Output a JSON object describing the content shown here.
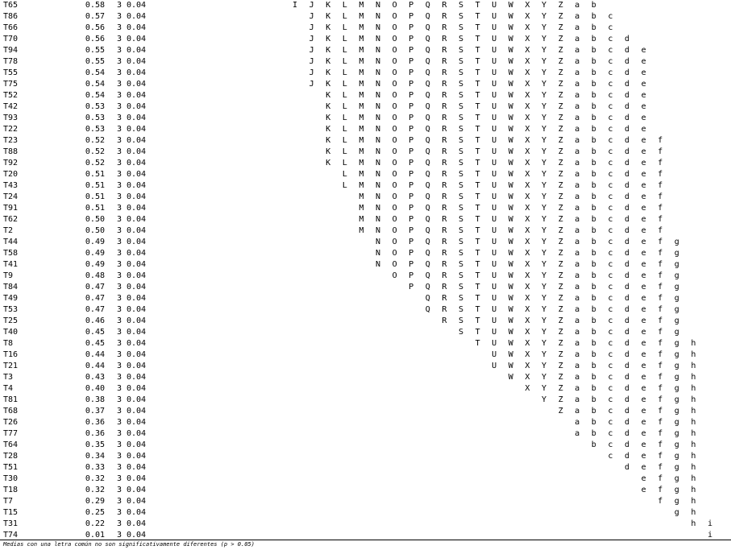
{
  "footnote": "Medias con una letra común no son significativamente diferentes (p > 0.05)",
  "rows": [
    {
      "name": "T65",
      "mean": "0.58",
      "n": "3",
      "ee": "0.04",
      "letters": "IJKLMNOPQRSTUWXYZab"
    },
    {
      "name": "T86",
      "mean": "0.57",
      "n": "3",
      "ee": "0.04",
      "letters": "JKLMNOPQRSTUWXYZabc"
    },
    {
      "name": "T66",
      "mean": "0.56",
      "n": "3",
      "ee": "0.04",
      "letters": "JKLMNOPQRSTUWXYZabc"
    },
    {
      "name": "T70",
      "mean": "0.56",
      "n": "3",
      "ee": "0.04",
      "letters": "JKLMNOPQRSTUWXYZabcd"
    },
    {
      "name": "T94",
      "mean": "0.55",
      "n": "3",
      "ee": "0.04",
      "letters": "JKLMNOPQRSTUWXYZabcde"
    },
    {
      "name": "T78",
      "mean": "0.55",
      "n": "3",
      "ee": "0.04",
      "letters": "JKLMNOPQRSTUWXYZabcde"
    },
    {
      "name": "T55",
      "mean": "0.54",
      "n": "3",
      "ee": "0.04",
      "letters": "JKLMNOPQRSTUWXYZabcde"
    },
    {
      "name": "T75",
      "mean": "0.54",
      "n": "3",
      "ee": "0.04",
      "letters": "JKLMNOPQRSTUWXYZabcde"
    },
    {
      "name": "T52",
      "mean": "0.54",
      "n": "3",
      "ee": "0.04",
      "letters": "KLMNOPQRSTUWXYZabcde"
    },
    {
      "name": "T42",
      "mean": "0.53",
      "n": "3",
      "ee": "0.04",
      "letters": "KLMNOPQRSTUWXYZabcde"
    },
    {
      "name": "T93",
      "mean": "0.53",
      "n": "3",
      "ee": "0.04",
      "letters": "KLMNOPQRSTUWXYZabcde"
    },
    {
      "name": "T22",
      "mean": "0.53",
      "n": "3",
      "ee": "0.04",
      "letters": "KLMNOPQRSTUWXYZabcde"
    },
    {
      "name": "T23",
      "mean": "0.52",
      "n": "3",
      "ee": "0.04",
      "letters": "KLMNOPQRSTUWXYZabcdef"
    },
    {
      "name": "T88",
      "mean": "0.52",
      "n": "3",
      "ee": "0.04",
      "letters": "KLMNOPQRSTUWXYZabcdef"
    },
    {
      "name": "T92",
      "mean": "0.52",
      "n": "3",
      "ee": "0.04",
      "letters": "KLMNOPQRSTUWXYZabcdef"
    },
    {
      "name": "T20",
      "mean": "0.51",
      "n": "3",
      "ee": "0.04",
      "letters": "LMNOPQRSTUWXYZabcdef"
    },
    {
      "name": "T43",
      "mean": "0.51",
      "n": "3",
      "ee": "0.04",
      "letters": "LMNOPQRSTUWXYZabcdef"
    },
    {
      "name": "T24",
      "mean": "0.51",
      "n": "3",
      "ee": "0.04",
      "letters": "MNOPQRSTUWXYZabcdef"
    },
    {
      "name": "T91",
      "mean": "0.51",
      "n": "3",
      "ee": "0.04",
      "letters": "MNOPQRSTUWXYZabcdef"
    },
    {
      "name": "T62",
      "mean": "0.50",
      "n": "3",
      "ee": "0.04",
      "letters": "MNOPQRSTUWXYZabcdef"
    },
    {
      "name": "T2",
      "mean": "0.50",
      "n": "3",
      "ee": "0.04",
      "letters": "MNOPQRSTUWXYZabcdef"
    },
    {
      "name": "T44",
      "mean": "0.49",
      "n": "3",
      "ee": "0.04",
      "letters": "NOPQRSTUWXYZabcdefg"
    },
    {
      "name": "T58",
      "mean": "0.49",
      "n": "3",
      "ee": "0.04",
      "letters": "NOPQRSTUWXYZabcdefg"
    },
    {
      "name": "T41",
      "mean": "0.49",
      "n": "3",
      "ee": "0.04",
      "letters": "NOPQRSTUWXYZabcdefg"
    },
    {
      "name": "T9",
      "mean": "0.48",
      "n": "3",
      "ee": "0.04",
      "letters": "OPQRSTUWXYZabcdefg"
    },
    {
      "name": "T84",
      "mean": "0.47",
      "n": "3",
      "ee": "0.04",
      "letters": "PQRSTUWXYZabcdefg"
    },
    {
      "name": "T49",
      "mean": "0.47",
      "n": "3",
      "ee": "0.04",
      "letters": "QRSTUWXYZabcdefg"
    },
    {
      "name": "T53",
      "mean": "0.47",
      "n": "3",
      "ee": "0.04",
      "letters": "QRSTUWXYZabcdefg"
    },
    {
      "name": "T25",
      "mean": "0.46",
      "n": "3",
      "ee": "0.04",
      "letters": "RSTUWXYZabcdefg"
    },
    {
      "name": "T40",
      "mean": "0.45",
      "n": "3",
      "ee": "0.04",
      "letters": "STUWXYZabcdefg"
    },
    {
      "name": "T8",
      "mean": "0.45",
      "n": "3",
      "ee": "0.04",
      "letters": "TUWXYZabcdefgh"
    },
    {
      "name": "T16",
      "mean": "0.44",
      "n": "3",
      "ee": "0.04",
      "letters": "UWXYZabcdefgh"
    },
    {
      "name": "T21",
      "mean": "0.44",
      "n": "3",
      "ee": "0.04",
      "letters": "UWXYZabcdefgh"
    },
    {
      "name": "T3",
      "mean": "0.43",
      "n": "3",
      "ee": "0.04",
      "letters": "WXYZabcdefgh"
    },
    {
      "name": "T4",
      "mean": "0.40",
      "n": "3",
      "ee": "0.04",
      "letters": "XYZabcdefgh"
    },
    {
      "name": "T81",
      "mean": "0.38",
      "n": "3",
      "ee": "0.04",
      "letters": "YZabcdefgh"
    },
    {
      "name": "T68",
      "mean": "0.37",
      "n": "3",
      "ee": "0.04",
      "letters": "Zabcdefgh"
    },
    {
      "name": "T26",
      "mean": "0.36",
      "n": "3",
      "ee": "0.04",
      "letters": "abcdefgh"
    },
    {
      "name": "T77",
      "mean": "0.36",
      "n": "3",
      "ee": "0.04",
      "letters": "abcdefgh"
    },
    {
      "name": "T64",
      "mean": "0.35",
      "n": "3",
      "ee": "0.04",
      "letters": "bcdefgh"
    },
    {
      "name": "T28",
      "mean": "0.34",
      "n": "3",
      "ee": "0.04",
      "letters": "cdefgh"
    },
    {
      "name": "T51",
      "mean": "0.33",
      "n": "3",
      "ee": "0.04",
      "letters": "defgh"
    },
    {
      "name": "T30",
      "mean": "0.32",
      "n": "3",
      "ee": "0.04",
      "letters": "efgh"
    },
    {
      "name": "T18",
      "mean": "0.32",
      "n": "3",
      "ee": "0.04",
      "letters": "efgh"
    },
    {
      "name": "T7",
      "mean": "0.29",
      "n": "3",
      "ee": "0.04",
      "letters": "fgh"
    },
    {
      "name": "T15",
      "mean": "0.25",
      "n": "3",
      "ee": "0.04",
      "letters": "gh"
    },
    {
      "name": "T31",
      "mean": "0.22",
      "n": "3",
      "ee": "0.04",
      "letters": "hi"
    },
    {
      "name": "T74",
      "mean": "0.01",
      "n": "3",
      "ee": "0.04",
      "letters": "i"
    }
  ]
}
